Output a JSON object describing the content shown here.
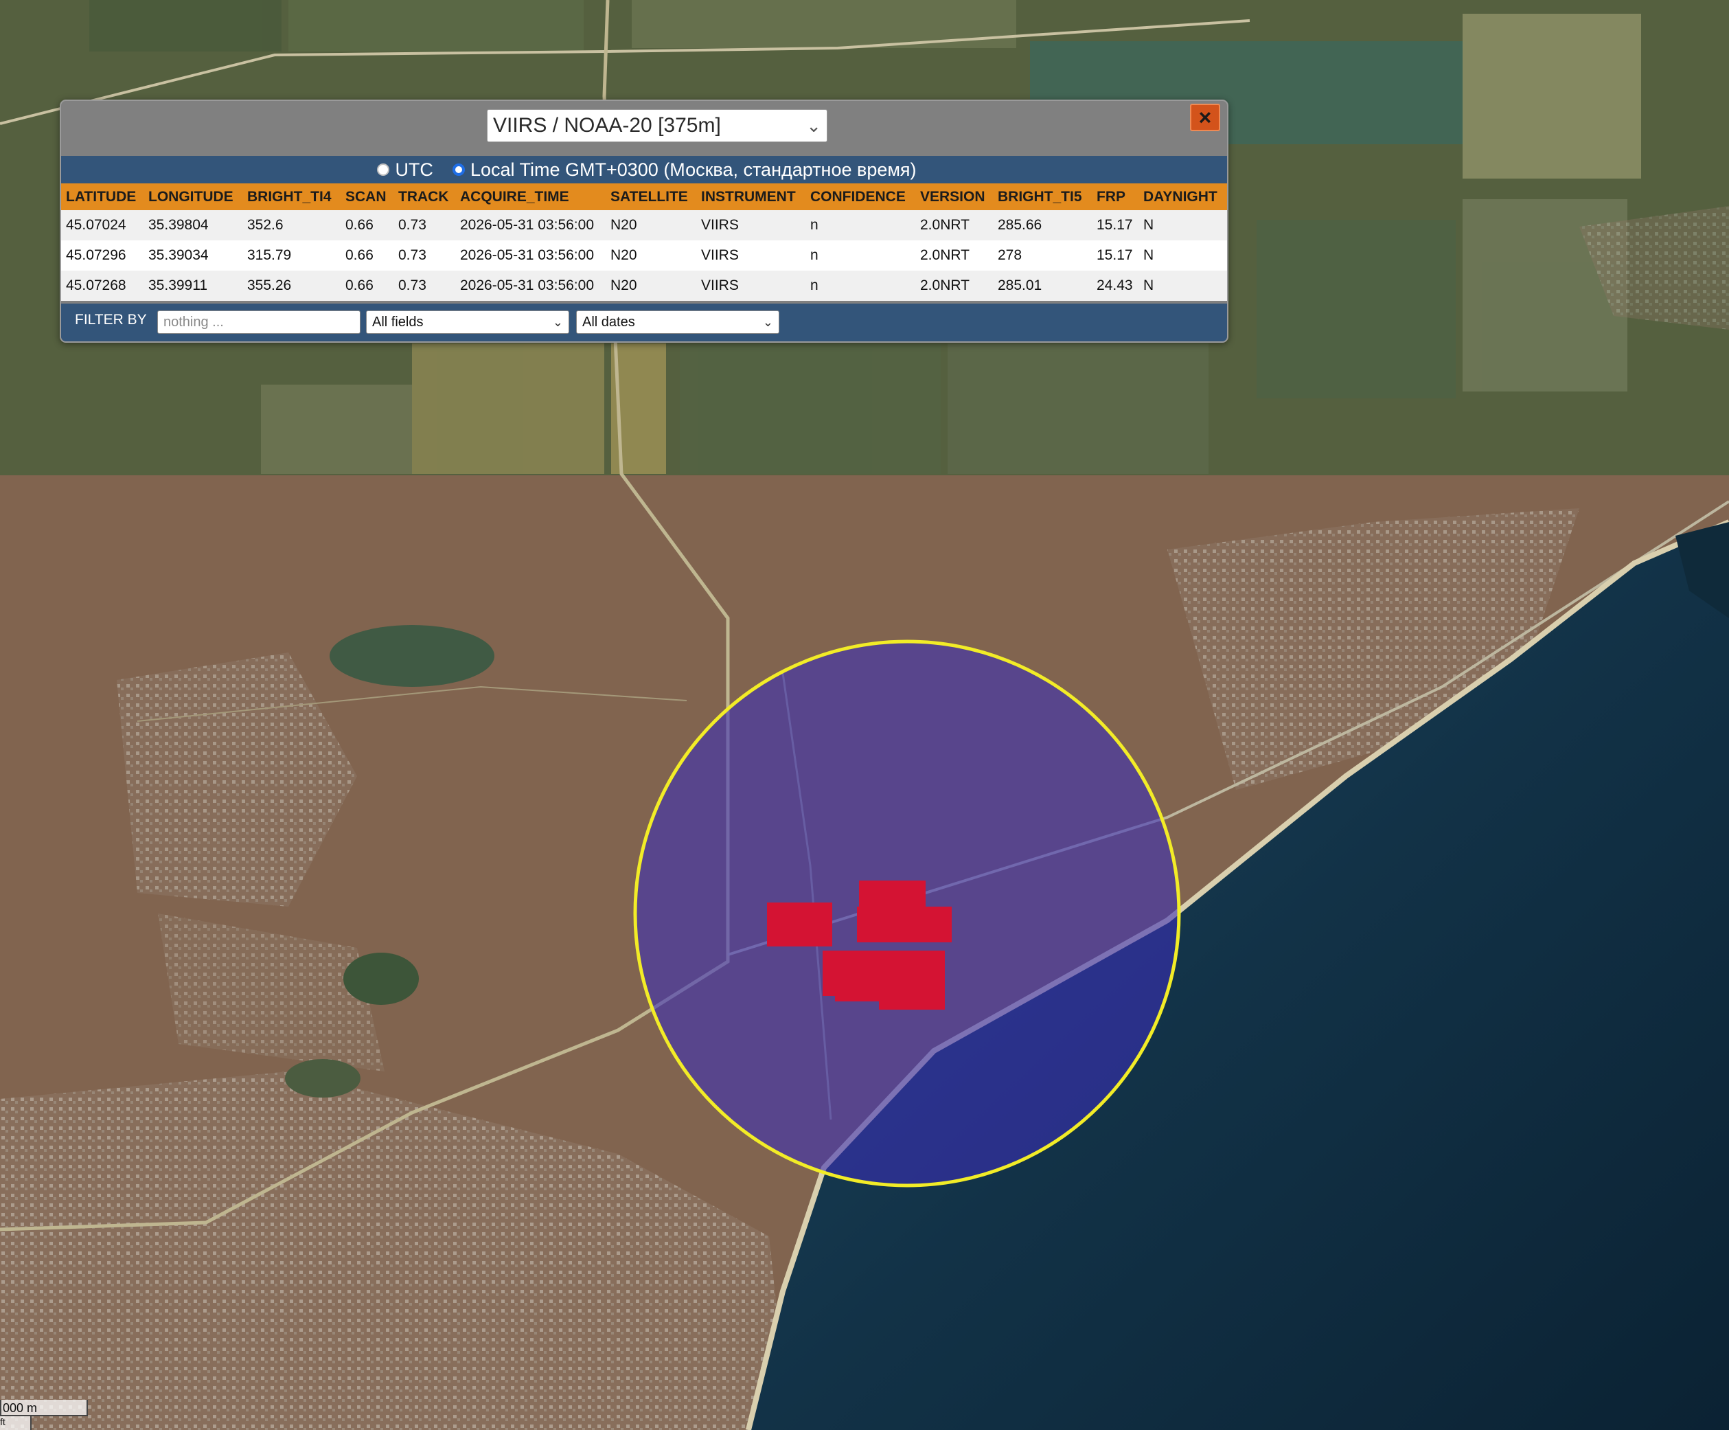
{
  "source_select": {
    "value": "VIIRS / NOAA-20 [375m]"
  },
  "close_icon": "×",
  "time_mode": {
    "utc_label": "UTC",
    "local_label": "Local Time GMT+0300 (Москва, стандартное время)",
    "selected": "local"
  },
  "table": {
    "columns": [
      "LATITUDE",
      "LONGITUDE",
      "BRIGHT_TI4",
      "SCAN",
      "TRACK",
      "ACQUIRE_TIME",
      "SATELLITE",
      "INSTRUMENT",
      "CONFIDENCE",
      "VERSION",
      "BRIGHT_TI5",
      "FRP",
      "DAYNIGHT"
    ],
    "rows": [
      [
        "45.07024",
        "35.39804",
        "352.6",
        "0.66",
        "0.73",
        "2026-05-31 03:56:00",
        "N20",
        "VIIRS",
        "n",
        "2.0NRT",
        "285.66",
        "15.17",
        "N"
      ],
      [
        "45.07296",
        "35.39034",
        "315.79",
        "0.66",
        "0.73",
        "2026-05-31 03:56:00",
        "N20",
        "VIIRS",
        "n",
        "2.0NRT",
        "278",
        "15.17",
        "N"
      ],
      [
        "45.07268",
        "35.39911",
        "355.26",
        "0.66",
        "0.73",
        "2026-05-31 03:56:00",
        "N20",
        "VIIRS",
        "n",
        "2.0NRT",
        "285.01",
        "24.43",
        "N"
      ]
    ]
  },
  "filter": {
    "label": "FILTER BY",
    "placeholder": "nothing ...",
    "field_select": "All fields",
    "date_select": "All dates"
  },
  "scale": {
    "label": "000 m",
    "sub": "ft"
  },
  "colors": {
    "fire_pixel": "#d41333",
    "search_circle_stroke": "#f2ec27",
    "search_circle_fill": "#3a2fb8",
    "table_header": "#e38b1e",
    "panel_bar": "#33557a",
    "close_button": "#d3531b"
  }
}
